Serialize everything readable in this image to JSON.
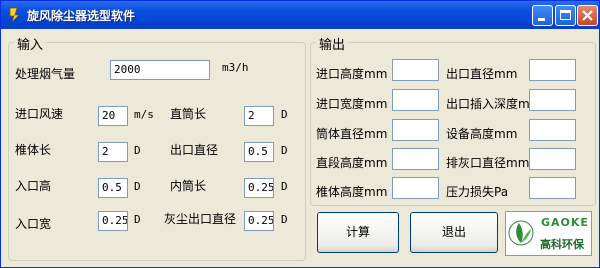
{
  "window": {
    "title": "旋风除尘器选型软件"
  },
  "titlebar_buttons": {
    "minimize": "minimize-icon",
    "maximize": "maximize-icon",
    "close": "close-icon"
  },
  "input_group": {
    "legend": "输入",
    "flue_gas_label": "处理烟气量",
    "flue_gas_value": "2000",
    "flue_gas_unit": "m3/h",
    "inlet_velocity_label": "进口风速",
    "inlet_velocity_value": "20",
    "inlet_velocity_unit": "m/s",
    "straight_tube_label": "直筒长",
    "straight_tube_value": "2",
    "straight_tube_unit": "D",
    "cone_length_label": "椎体长",
    "cone_length_value": "2",
    "cone_length_unit": "D",
    "outlet_diameter_label": "出口直径",
    "outlet_diameter_value": "0.5",
    "outlet_diameter_unit": "D",
    "inlet_height_label": "入口高",
    "inlet_height_value": "0.5",
    "inlet_height_unit": "D",
    "inner_tube_label": "内筒长",
    "inner_tube_value": "0.25",
    "inner_tube_unit": "D",
    "inlet_width_label": "入口宽",
    "inlet_width_value": "0.25",
    "inlet_width_unit": "D",
    "dust_outlet_label": "灰尘出口直径",
    "dust_outlet_value": "0.25",
    "dust_outlet_unit": "D"
  },
  "output_group": {
    "legend": "输出",
    "inlet_height_label": "进口高度mm",
    "inlet_width_label": "进口宽度mm",
    "cylinder_diameter_label": "筒体直径mm",
    "straight_height_label": "直段高度mm",
    "cone_height_label": "椎体高度mm",
    "outlet_diameter_label": "出口直径mm",
    "outlet_insert_depth_label": "出口插入深度mm",
    "equipment_height_label": "设备高度mm",
    "ash_outlet_diameter_label": "排灰口直径mm",
    "pressure_loss_label": "压力损失Pa"
  },
  "buttons": {
    "calculate": "计算",
    "exit": "退出"
  },
  "logo": {
    "brand": "GAOKE",
    "chinese": "高科环保"
  },
  "colors": {
    "titlebar": "#0A4EE0",
    "face": "#ECE9D8",
    "logo_green": "#2E8B3A"
  }
}
